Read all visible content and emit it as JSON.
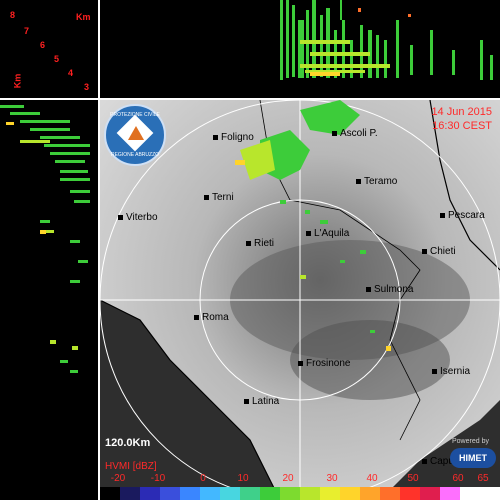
{
  "map": {
    "timestamp": {
      "date": "14 Jun 2015",
      "time": "16:30 CEST"
    },
    "range_label": "120.0Km",
    "product_label": "HVMI [dBZ]",
    "logo_text": [
      "PROTEZIONE CIVILE",
      "REGIONE ABRUZZO"
    ],
    "powered_by": "Powered by",
    "brand": "HIMET",
    "cities": [
      {
        "name": "Foligno"
      },
      {
        "name": "Ascoli P."
      },
      {
        "name": "Teramo"
      },
      {
        "name": "Terni"
      },
      {
        "name": "Viterbo"
      },
      {
        "name": "Pescara"
      },
      {
        "name": "L'Aquila"
      },
      {
        "name": "Rieti"
      },
      {
        "name": "Chieti"
      },
      {
        "name": "Sulmona"
      },
      {
        "name": "Roma"
      },
      {
        "name": "Frosinone"
      },
      {
        "name": "Isernia"
      },
      {
        "name": "Latina"
      },
      {
        "name": "Capua"
      }
    ]
  },
  "side_panels": {
    "unit": "Km",
    "km_levels": [
      "8",
      "7",
      "6",
      "5",
      "4",
      "3"
    ]
  },
  "colorbar": {
    "tick_labels": [
      "-20",
      "-10",
      "0",
      "10",
      "20",
      "30",
      "40",
      "50",
      "60",
      "65"
    ],
    "colors": [
      "#000000",
      "#1a1a5e",
      "#2b2bb5",
      "#3a4fdc",
      "#3a86ff",
      "#43b8ff",
      "#48d6e0",
      "#3fd08a",
      "#3dcc3a",
      "#7ddb2f",
      "#b8e62c",
      "#e8ee2e",
      "#ffd42a",
      "#ffa42a",
      "#ff6f2a",
      "#ff332a",
      "#e01e4e",
      "#ff70ff",
      "#ffffff",
      "#ffffff"
    ]
  }
}
